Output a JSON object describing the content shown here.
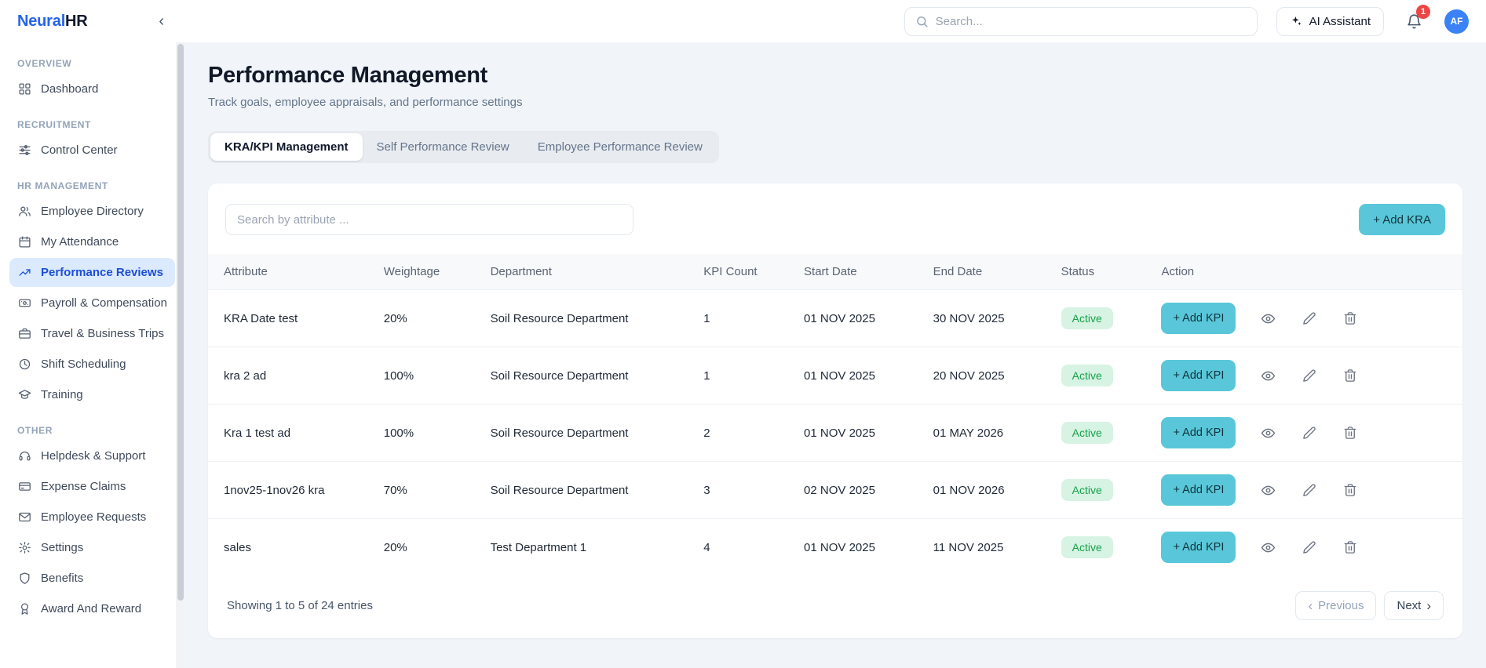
{
  "colors": {
    "brand_blue": "#2563eb",
    "accent_teal": "#59c7d9",
    "accent_teal_text": "#10333c",
    "active_nav_bg": "#dbeafe",
    "active_nav_text": "#1d4ed8",
    "status_active_bg": "#d7f3e3",
    "status_active_text": "#16a34a",
    "badge_red": "#ef4444",
    "avatar_blue": "#3b82f6",
    "page_bg": "#f1f5f9"
  },
  "icons": {
    "collapse": "‹",
    "chevron_left": "‹",
    "chevron_right": "›"
  },
  "brand": {
    "name_primary": "Neural",
    "name_secondary": "HR"
  },
  "topbar": {
    "search_placeholder": "Search...",
    "ai_assistant_label": "AI Assistant",
    "notification_count": "1",
    "avatar_initials": "AF"
  },
  "sidebar": {
    "sections": [
      {
        "heading": "OVERVIEW",
        "items": [
          {
            "label": "Dashboard",
            "icon": "dashboard-icon"
          }
        ]
      },
      {
        "heading": "RECRUITMENT",
        "items": [
          {
            "label": "Control Center",
            "icon": "sliders-icon"
          }
        ]
      },
      {
        "heading": "HR MANAGEMENT",
        "items": [
          {
            "label": "Employee Directory",
            "icon": "users-icon"
          },
          {
            "label": "My Attendance",
            "icon": "calendar-icon"
          },
          {
            "label": "Performance Reviews",
            "icon": "chart-icon",
            "active": true
          },
          {
            "label": "Payroll & Compensation",
            "icon": "banknote-icon"
          },
          {
            "label": "Travel & Business Trips",
            "icon": "briefcase-icon"
          },
          {
            "label": "Shift Scheduling",
            "icon": "clock-icon"
          },
          {
            "label": "Training",
            "icon": "graduation-icon"
          }
        ]
      },
      {
        "heading": "OTHER",
        "items": [
          {
            "label": "Helpdesk & Support",
            "icon": "headset-icon"
          },
          {
            "label": "Expense Claims",
            "icon": "credit-card-icon"
          },
          {
            "label": "Employee Requests",
            "icon": "mail-icon"
          },
          {
            "label": "Settings",
            "icon": "gear-icon"
          },
          {
            "label": "Benefits",
            "icon": "shield-icon"
          },
          {
            "label": "Award And Reward",
            "icon": "award-icon"
          }
        ]
      }
    ]
  },
  "page": {
    "title": "Performance Management",
    "subtitle": "Track goals, employee appraisals, and performance settings",
    "tabs": [
      {
        "label": "KRA/KPI Management",
        "active": true
      },
      {
        "label": "Self Performance Review",
        "active": false
      },
      {
        "label": "Employee Performance Review",
        "active": false
      }
    ]
  },
  "panel": {
    "search_placeholder": "Search by attribute ...",
    "add_kra_label": "+ Add KRA",
    "add_kpi_label": "+ Add KPI",
    "table": {
      "columns": [
        "Attribute",
        "Weightage",
        "Department",
        "KPI Count",
        "Start Date",
        "End Date",
        "Status",
        "Action"
      ],
      "rows": [
        {
          "attribute": "KRA Date test",
          "weightage": "20%",
          "department": "Soil Resource Department",
          "kpi_count": "1",
          "start_date": "01 NOV 2025",
          "end_date": "30 NOV 2025",
          "status": "Active"
        },
        {
          "attribute": "kra 2 ad",
          "weightage": "100%",
          "department": "Soil Resource Department",
          "kpi_count": "1",
          "start_date": "01 NOV 2025",
          "end_date": "20 NOV 2025",
          "status": "Active"
        },
        {
          "attribute": "Kra 1 test ad",
          "weightage": "100%",
          "department": "Soil Resource Department",
          "kpi_count": "2",
          "start_date": "01 NOV 2025",
          "end_date": "01 MAY 2026",
          "status": "Active"
        },
        {
          "attribute": "1nov25-1nov26 kra",
          "weightage": "70%",
          "department": "Soil Resource Department",
          "kpi_count": "3",
          "start_date": "02 NOV 2025",
          "end_date": "01 NOV 2026",
          "status": "Active"
        },
        {
          "attribute": "sales",
          "weightage": "20%",
          "department": "Test Department 1",
          "kpi_count": "4",
          "start_date": "01 NOV 2025",
          "end_date": "11 NOV 2025",
          "status": "Active"
        }
      ]
    },
    "footer": {
      "showing_text": "Showing 1 to 5 of 24 entries",
      "previous_label": "Previous",
      "next_label": "Next"
    }
  }
}
